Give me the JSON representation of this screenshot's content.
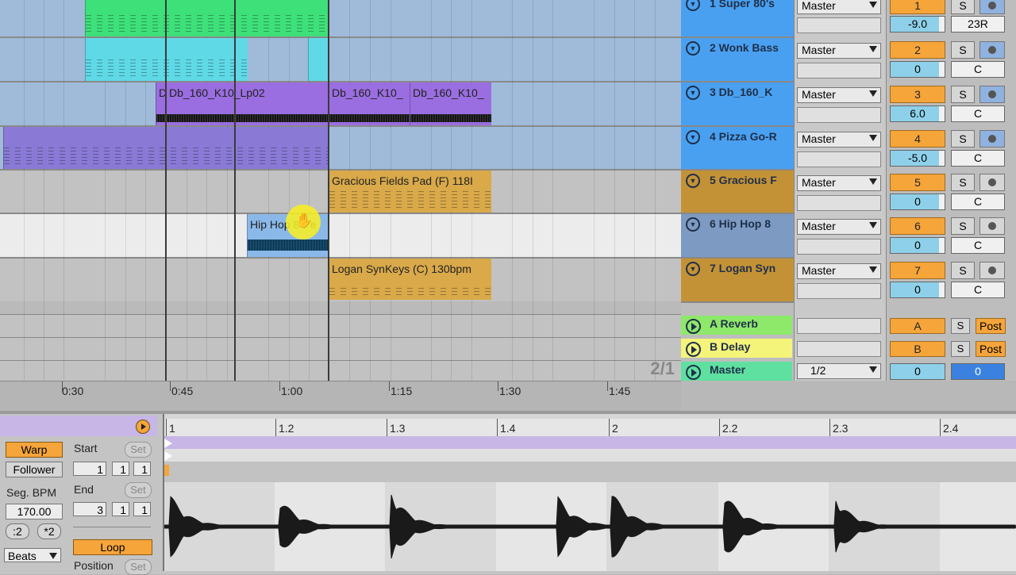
{
  "arrangement": {
    "clips": {
      "lp02": "Db_160_K10_Lp02",
      "lp02_cont1": "Db_160_K10_",
      "lp02_cont2": "Db_160_K10_",
      "lp02_short": "D",
      "gracious": "Gracious Fields Pad (F) 118I",
      "hiphop": "Hip Hop 8 Pe",
      "logan": "Logan SynKeys (C) 130bpm"
    },
    "time_labels": [
      "0:30",
      "0:45",
      "1:00",
      "1:15",
      "1:30",
      "1:45"
    ],
    "page_indicator": "2/1"
  },
  "tracks": [
    {
      "name": "1 Super 80's",
      "routing": "Master",
      "number": "1",
      "solo": "S",
      "volume": "-9.0",
      "pan": "23R",
      "color": "#4aa0f0",
      "monitor": "blue"
    },
    {
      "name": "2 Wonk Bass",
      "routing": "Master",
      "number": "2",
      "solo": "S",
      "volume": "0",
      "pan": "C",
      "color": "#4aa0f0",
      "monitor": "blue"
    },
    {
      "name": "3 Db_160_K",
      "routing": "Master",
      "number": "3",
      "solo": "S",
      "volume": "6.0",
      "pan": "C",
      "color": "#4aa0f0",
      "monitor": "blue"
    },
    {
      "name": "4 Pizza Go-R",
      "routing": "Master",
      "number": "4",
      "solo": "S",
      "volume": "-5.0",
      "pan": "C",
      "color": "#4aa0f0",
      "monitor": "blue"
    },
    {
      "name": "5 Gracious F",
      "routing": "Master",
      "number": "5",
      "solo": "S",
      "volume": "0",
      "pan": "C",
      "color": "#c49236",
      "monitor": "gray"
    },
    {
      "name": "6 Hip Hop 8",
      "routing": "Master",
      "number": "6",
      "solo": "S",
      "volume": "0",
      "pan": "C",
      "color": "#7d9ac2",
      "monitor": "gray"
    },
    {
      "name": "7 Logan Syn",
      "routing": "Master",
      "number": "7",
      "solo": "S",
      "volume": "0",
      "pan": "C",
      "color": "#c49236",
      "monitor": "gray"
    }
  ],
  "returns": [
    {
      "name": "A Reverb",
      "letter": "A",
      "solo": "S",
      "post": "Post",
      "color": "#8ee86a"
    },
    {
      "name": "B Delay",
      "letter": "B",
      "solo": "S",
      "post": "Post",
      "color": "#f4f47a"
    }
  ],
  "master": {
    "name": "Master",
    "routing": "1/2",
    "volume": "0",
    "pan": "0",
    "color": "#5fe0a0"
  },
  "clipview": {
    "warp": "Warp",
    "follower": "Follower",
    "seg_bpm_label": "Seg. BPM",
    "seg_bpm": "170.00",
    "half": ":2",
    "double": "*2",
    "beats": "Beats",
    "start_label": "Start",
    "start": [
      "1",
      "1",
      "1"
    ],
    "end_label": "End",
    "end": [
      "3",
      "1",
      "1"
    ],
    "set": "Set",
    "loop": "Loop",
    "position_label": "Position",
    "beat_labels": [
      "1",
      "1.2",
      "1.3",
      "1.4",
      "2",
      "2.2",
      "2.3",
      "2.4"
    ]
  }
}
